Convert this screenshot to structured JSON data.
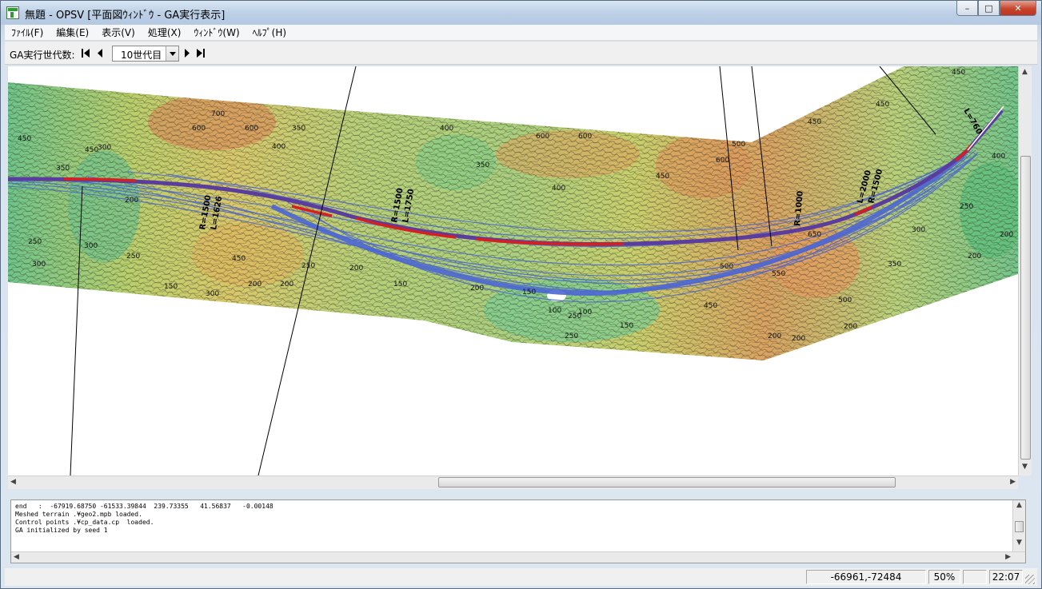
{
  "window": {
    "title": "無題 - OPSV [平面図ｳｨﾝﾄﾞｳ - GA実行表示]",
    "min_glyph": "–",
    "max_glyph": "□",
    "close_glyph": "✕"
  },
  "menu": [
    {
      "label": "ﾌｧｲﾙ(F)"
    },
    {
      "label": "編集(E)"
    },
    {
      "label": "表示(V)"
    },
    {
      "label": "処理(X)"
    },
    {
      "label": "ｳｨﾝﾄﾞｳ(W)"
    },
    {
      "label": "ﾍﾙﾌﾟ(H)"
    }
  ],
  "toolbar": {
    "generation_label": "GA実行世代数:",
    "generation_value": "10世代目"
  },
  "map": {
    "contour_labels": [
      "450",
      "600",
      "350",
      "400",
      "650",
      "700",
      "300",
      "250",
      "200",
      "150",
      "100",
      "500",
      "550"
    ],
    "curve_labels": [
      "R=1500",
      "L=1626",
      "R=1500",
      "L=1750",
      "R=1000",
      "L=2000",
      "R=1500",
      "L=760"
    ]
  },
  "log": {
    "lines": [
      "end   :  -67919.68750 -61533.39844  239.73355   41.56837   -0.00148",
      "Meshed terrain .¥geo2.mpb loaded.",
      "Control points .¥cp_data.cp  loaded.",
      "GA initialized by seed 1"
    ]
  },
  "status": {
    "coords": "-66961,-72484",
    "zoom": "50%",
    "time": "22:07"
  },
  "colors": {
    "route_main": "#5a3d9e",
    "route_highlight": "#d81e1e",
    "route_candidates": "#3f5fd0",
    "terrain_low": "#5fbf7a",
    "terrain_mid": "#d7d86a",
    "terrain_high": "#d79050"
  }
}
